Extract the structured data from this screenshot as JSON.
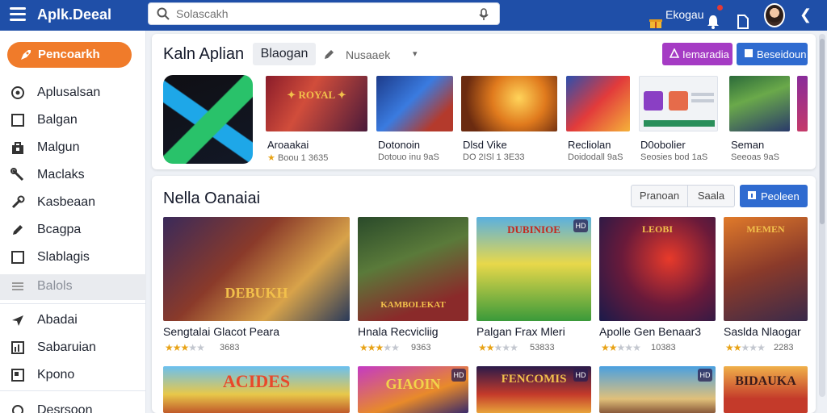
{
  "header": {
    "brand": "Aplk.Deeal",
    "search_placeholder": "Solascakh",
    "shop_label": "Ekogau"
  },
  "sidebar": {
    "cta_label": "Pencoarkh",
    "items": [
      {
        "label": "Aplusalsan",
        "icon": "globe-icon"
      },
      {
        "label": "Balgan",
        "icon": "square-icon"
      },
      {
        "label": "Malgun",
        "icon": "bag-icon"
      },
      {
        "label": "Maclaks",
        "icon": "tools-icon"
      },
      {
        "label": "Kasbeaan",
        "icon": "wrench-icon"
      },
      {
        "label": "Bcagpa",
        "icon": "pencil-icon"
      },
      {
        "label": "Slablagis",
        "icon": "square-icon"
      },
      {
        "label": "Balols",
        "icon": "list-icon",
        "active": true
      },
      {
        "label": "Abadai",
        "icon": "plane-icon"
      },
      {
        "label": "Sabaruian",
        "icon": "chart-icon"
      },
      {
        "label": "Kpono",
        "icon": "box-icon"
      },
      {
        "label": "Desrsoon",
        "icon": "circle-icon"
      }
    ]
  },
  "featured": {
    "title": "Kaln Aplian",
    "tab_label": "Blaogan",
    "filter_label": "Nusaaek",
    "btn_primary": "Iemaradia",
    "btn_secondary": "Beseidoun",
    "apps": [
      {
        "name": "Aroaakai",
        "sub": "Boou   1 3635"
      },
      {
        "name": "Dotonoin",
        "sub": "Dotouo inu 9aS"
      },
      {
        "name": "Dlsd Vike",
        "sub": "DO 2ISl 1 3E33"
      },
      {
        "name": "Recliolan",
        "sub": "Doidodall 9aS"
      },
      {
        "name": "D0obolier",
        "sub": "Seosies bod 1aS"
      },
      {
        "name": "Seman",
        "sub": "Seeoas 9aS"
      }
    ]
  },
  "games": {
    "title": "Nella Oanaiai",
    "ctl_a": "Pranoan",
    "ctl_b": "Saala",
    "btn_label": "Peoleen",
    "items": [
      {
        "name": "Sengtalai Glacot Peara",
        "rating": 3,
        "count": "3683",
        "art_text": "DEBUKH"
      },
      {
        "name": "Hnala Recvicliig",
        "rating": 3,
        "count": "9363",
        "art_text": "KAMBOLEKAT"
      },
      {
        "name": "Palgan Frax Mleri",
        "rating": 2,
        "count": "53833",
        "art_text": "DUBINIOE"
      },
      {
        "name": "Apolle Gen Benaar3",
        "rating": 2,
        "count": "10383",
        "art_text": "LEOBI"
      },
      {
        "name": "Saslda Nlaogar",
        "rating": 2,
        "count": "2283",
        "art_text": "MEMEN"
      }
    ],
    "row3": [
      {
        "art_text": "ACIDES"
      },
      {
        "art_text": "GIAOIN"
      },
      {
        "art_text": "FENCOMIS"
      },
      {
        "art_text": ""
      },
      {
        "art_text": "BIDAUKA"
      }
    ]
  },
  "colors": {
    "topbar": "#1f4fa8",
    "cta": "#f07b2a",
    "purple_button": "#a53bc4",
    "blue_button": "#2f6bd0",
    "star": "#e8a317"
  }
}
